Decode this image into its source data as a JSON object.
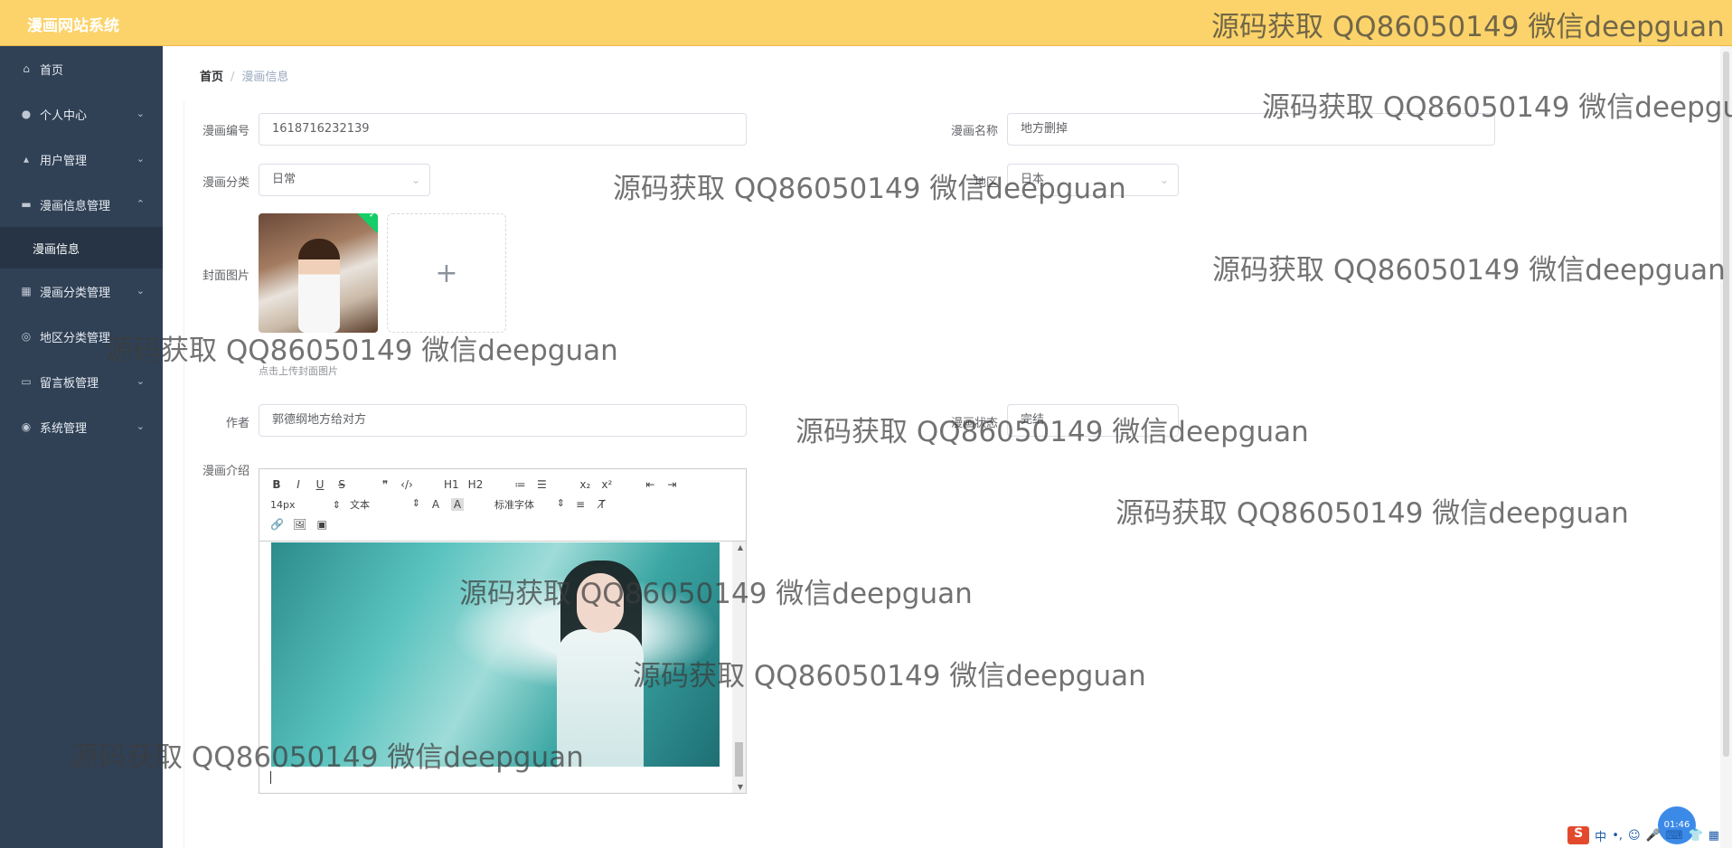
{
  "app": {
    "title": "漫画网站系统",
    "top_right": ""
  },
  "sidebar": {
    "items": [
      {
        "label": "首页",
        "icon": "home-icon"
      },
      {
        "label": "个人中心",
        "icon": "user-icon"
      },
      {
        "label": "用户管理",
        "icon": "users-icon"
      },
      {
        "label": "漫画信息管理",
        "icon": "briefcase-icon"
      },
      {
        "label": "漫画信息"
      },
      {
        "label": "漫画分类管理",
        "icon": "grid-icon"
      },
      {
        "label": "地区分类管理",
        "icon": "compass-icon"
      },
      {
        "label": "留言板管理",
        "icon": "monitor-icon"
      },
      {
        "label": "系统管理",
        "icon": "pin-icon"
      }
    ]
  },
  "breadcrumb": {
    "home": "首页",
    "separator": "/",
    "current": "漫画信息"
  },
  "form": {
    "id_label": "漫画编号",
    "id_value": "1618716232139",
    "name_label": "漫画名称",
    "name_value": "地方删掉",
    "category_label": "漫画分类",
    "category_value": "日常",
    "region_label": "地区",
    "region_value": "日本",
    "cover_label": "封面图片",
    "cover_tip": "点击上传封面图片",
    "author_label": "作者",
    "author_value": "郭德纲地方给对方",
    "status_label": "漫画状态",
    "status_value": "完结",
    "intro_label": "漫画介绍"
  },
  "editor": {
    "toolbar_row1": [
      "B",
      "I",
      "U",
      "S",
      "❞",
      "‹/›",
      "H1",
      "H2",
      "≔",
      "☰",
      "x₂",
      "x²",
      "⇤",
      "⇥"
    ],
    "font_size": "14px",
    "text_type": "文本",
    "font_family": "标准字体",
    "row3": [
      "🔗",
      "🖼",
      "▣"
    ]
  },
  "watermark": "源码获取 QQ86050149 微信deepguan",
  "tray": {
    "ime": "中",
    "time": "01:46"
  }
}
